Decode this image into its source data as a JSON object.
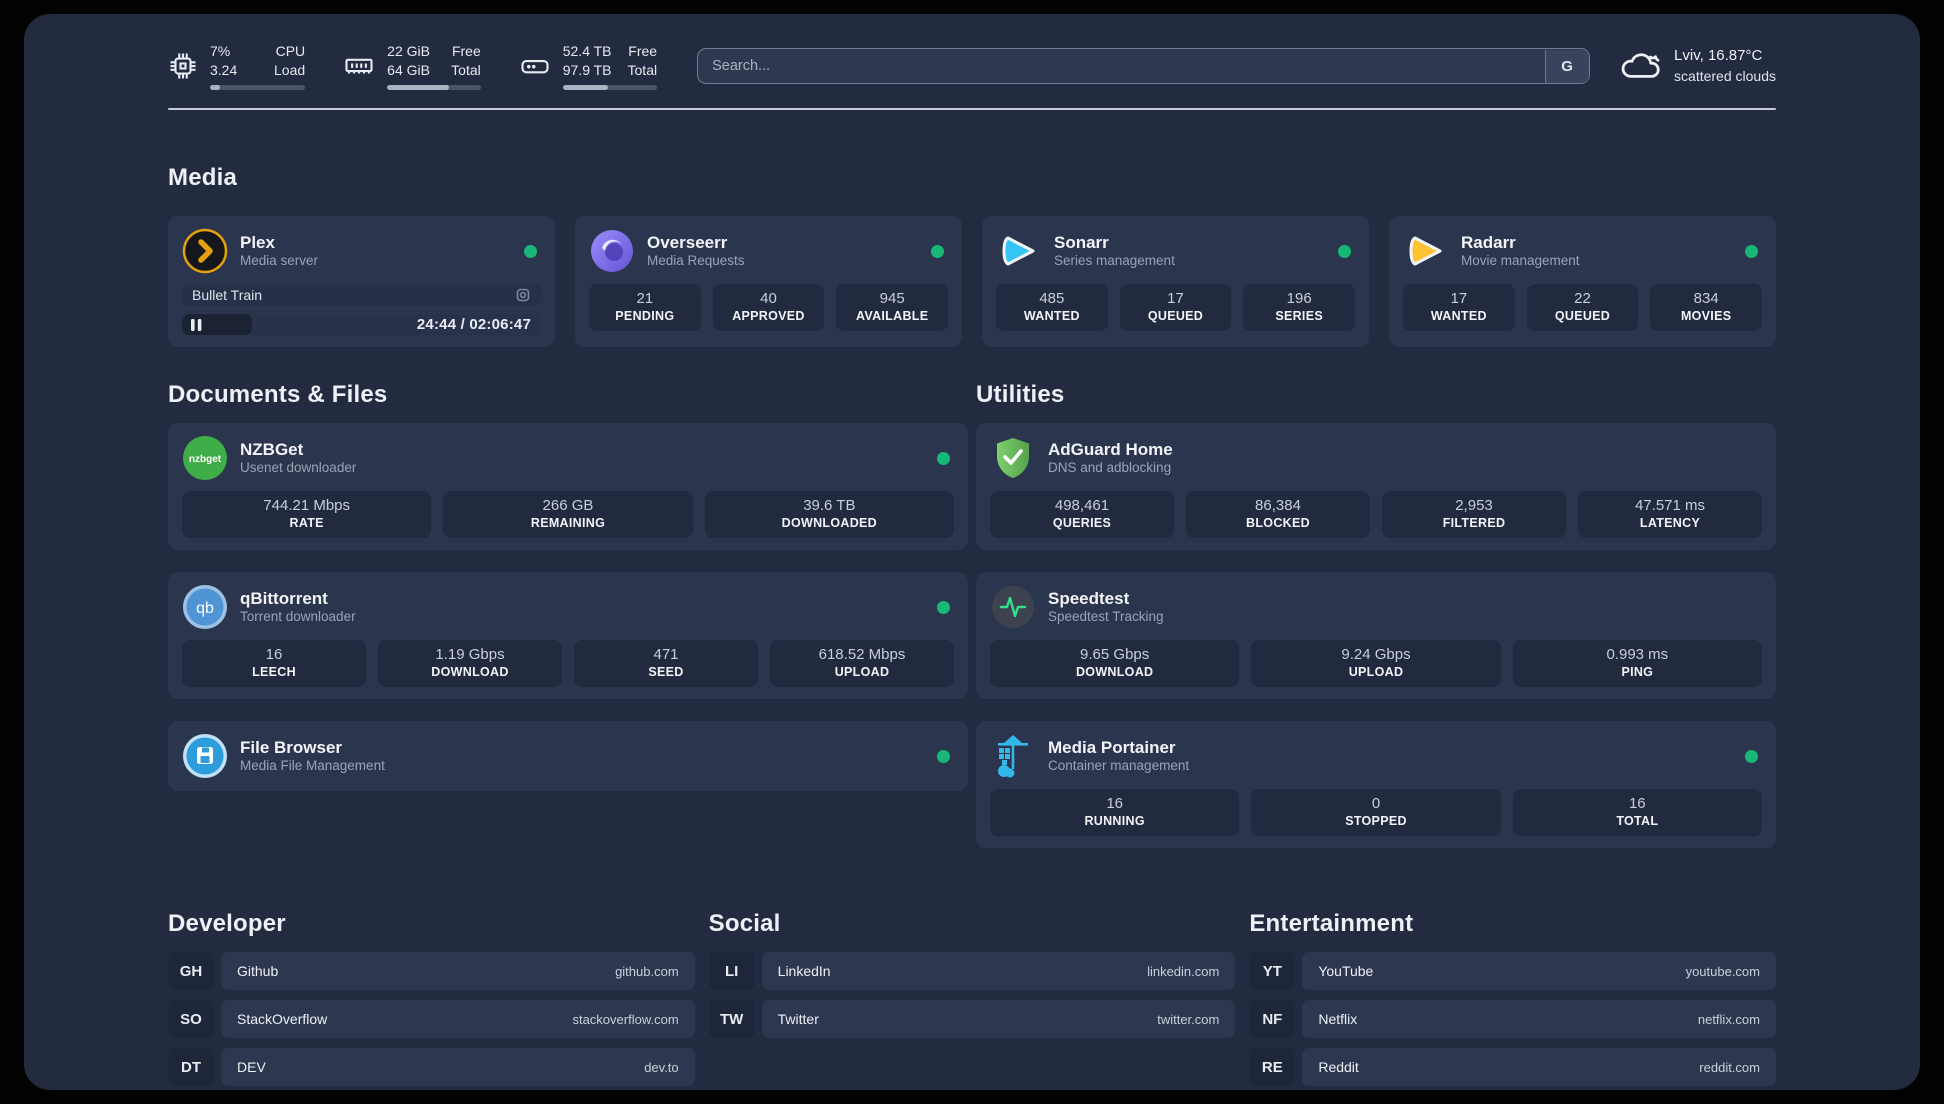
{
  "header": {
    "metrics": [
      {
        "name": "cpu",
        "value_top": "7%",
        "value_bottom": "3.24",
        "label_top": "CPU",
        "label_bottom": "Load",
        "progress_pct": 10
      },
      {
        "name": "memory",
        "value_top": "22 GiB",
        "value_bottom": "64 GiB",
        "label_top": "Free",
        "label_bottom": "Total",
        "progress_pct": 66
      },
      {
        "name": "storage",
        "value_top": "52.4 TB",
        "value_bottom": "97.9 TB",
        "label_top": "Free",
        "label_bottom": "Total",
        "progress_pct": 48
      }
    ],
    "search": {
      "placeholder": "Search...",
      "engine_button": "G"
    },
    "weather": {
      "location_temp": "Lviv, 16.87°C",
      "condition": "scattered clouds"
    }
  },
  "sections": {
    "media": "Media",
    "documents": "Documents & Files",
    "utilities": "Utilities",
    "developer": "Developer",
    "social": "Social",
    "entertainment": "Entertainment"
  },
  "apps": {
    "plex": {
      "name": "Plex",
      "desc": "Media server",
      "now_playing": {
        "title": "Bullet Train",
        "time": "24:44 / 02:06:47",
        "progress_pct": 19.5
      }
    },
    "overseerr": {
      "name": "Overseerr",
      "desc": "Media Requests",
      "stats": [
        {
          "value": "21",
          "label": "PENDING"
        },
        {
          "value": "40",
          "label": "APPROVED"
        },
        {
          "value": "945",
          "label": "AVAILABLE"
        }
      ]
    },
    "sonarr": {
      "name": "Sonarr",
      "desc": "Series management",
      "stats": [
        {
          "value": "485",
          "label": "WANTED"
        },
        {
          "value": "17",
          "label": "QUEUED"
        },
        {
          "value": "196",
          "label": "SERIES"
        }
      ]
    },
    "radarr": {
      "name": "Radarr",
      "desc": "Movie management",
      "stats": [
        {
          "value": "17",
          "label": "WANTED"
        },
        {
          "value": "22",
          "label": "QUEUED"
        },
        {
          "value": "834",
          "label": "MOVIES"
        }
      ]
    },
    "nzbget": {
      "name": "NZBGet",
      "desc": "Usenet downloader",
      "icon_text": "nzbget",
      "stats": [
        {
          "value": "744.21 Mbps",
          "label": "RATE"
        },
        {
          "value": "266 GB",
          "label": "REMAINING"
        },
        {
          "value": "39.6 TB",
          "label": "DOWNLOADED"
        }
      ]
    },
    "qbittorrent": {
      "name": "qBittorrent",
      "desc": "Torrent downloader",
      "icon_text": "qb",
      "stats": [
        {
          "value": "16",
          "label": "LEECH"
        },
        {
          "value": "1.19 Gbps",
          "label": "DOWNLOAD"
        },
        {
          "value": "471",
          "label": "SEED"
        },
        {
          "value": "618.52 Mbps",
          "label": "UPLOAD"
        }
      ]
    },
    "filebrowser": {
      "name": "File Browser",
      "desc": "Media File Management"
    },
    "adguard": {
      "name": "AdGuard Home",
      "desc": "DNS and adblocking",
      "stats": [
        {
          "value": "498,461",
          "label": "QUERIES"
        },
        {
          "value": "86,384",
          "label": "BLOCKED"
        },
        {
          "value": "2,953",
          "label": "FILTERED"
        },
        {
          "value": "47.571 ms",
          "label": "LATENCY"
        }
      ]
    },
    "speedtest": {
      "name": "Speedtest",
      "desc": "Speedtest Tracking",
      "stats": [
        {
          "value": "9.65 Gbps",
          "label": "DOWNLOAD"
        },
        {
          "value": "9.24 Gbps",
          "label": "UPLOAD"
        },
        {
          "value": "0.993 ms",
          "label": "PING"
        }
      ]
    },
    "portainer": {
      "name": "Media Portainer",
      "desc": "Container management",
      "stats": [
        {
          "value": "16",
          "label": "RUNNING"
        },
        {
          "value": "0",
          "label": "STOPPED"
        },
        {
          "value": "16",
          "label": "TOTAL"
        }
      ]
    }
  },
  "links": {
    "developer": [
      {
        "abbr": "GH",
        "name": "Github",
        "url": "github.com"
      },
      {
        "abbr": "SO",
        "name": "StackOverflow",
        "url": "stackoverflow.com"
      },
      {
        "abbr": "DT",
        "name": "DEV",
        "url": "dev.to"
      }
    ],
    "social": [
      {
        "abbr": "LI",
        "name": "LinkedIn",
        "url": "linkedin.com"
      },
      {
        "abbr": "TW",
        "name": "Twitter",
        "url": "twitter.com"
      }
    ],
    "entertainment": [
      {
        "abbr": "YT",
        "name": "YouTube",
        "url": "youtube.com"
      },
      {
        "abbr": "NF",
        "name": "Netflix",
        "url": "netflix.com"
      },
      {
        "abbr": "RE",
        "name": "Reddit",
        "url": "reddit.com"
      }
    ]
  },
  "colors": {
    "accent_green": "#17b877",
    "plex_amber": "#e5a00d",
    "sonarr_blue": "#35c5f4",
    "radarr_yellow": "#ffc230"
  }
}
